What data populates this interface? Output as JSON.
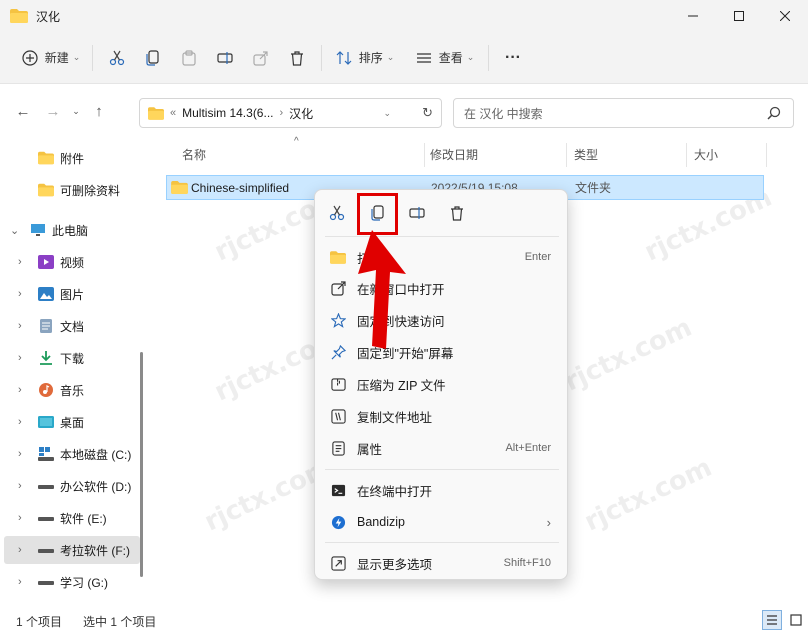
{
  "window": {
    "title": "汉化"
  },
  "toolbar": {
    "new_label": "新建",
    "sort_label": "排序",
    "view_label": "查看",
    "more_label": "···"
  },
  "navbar": {
    "path_prefix": "«",
    "path_1": "Multisim 14.3(6...",
    "path_sep": "›",
    "path_2": "汉化",
    "search_placeholder": "在 汉化 中搜索"
  },
  "sidebar": {
    "items": [
      {
        "label": "附件"
      },
      {
        "label": "可删除资料"
      },
      {
        "label": "此电脑"
      },
      {
        "label": "视频"
      },
      {
        "label": "图片"
      },
      {
        "label": "文档"
      },
      {
        "label": "下载"
      },
      {
        "label": "音乐"
      },
      {
        "label": "桌面"
      },
      {
        "label": "本地磁盘 (C:)"
      },
      {
        "label": "办公软件 (D:)"
      },
      {
        "label": "软件 (E:)"
      },
      {
        "label": "考拉软件 (F:)"
      },
      {
        "label": "学习 (G:)"
      }
    ]
  },
  "columns": {
    "name": "名称",
    "modified": "修改日期",
    "type": "类型",
    "size": "大小"
  },
  "files": [
    {
      "name": "Chinese-simplified",
      "modified": "2022/5/19 15:08",
      "type": "文件夹"
    }
  ],
  "status": {
    "count": "1 个项目",
    "selected": "选中 1 个项目"
  },
  "context_menu": {
    "items": [
      {
        "label": "打开",
        "shortcut": "Enter"
      },
      {
        "label": "在新窗口中打开",
        "shortcut": ""
      },
      {
        "label": "固定到快速访问",
        "shortcut": ""
      },
      {
        "label": "固定到\"开始\"屏幕",
        "shortcut": ""
      },
      {
        "label": "压缩为 ZIP 文件",
        "shortcut": ""
      },
      {
        "label": "复制文件地址",
        "shortcut": ""
      },
      {
        "label": "属性",
        "shortcut": "Alt+Enter"
      },
      {
        "label": "在终端中打开",
        "shortcut": ""
      },
      {
        "label": "Bandizip",
        "shortcut": ""
      },
      {
        "label": "显示更多选项",
        "shortcut": "Shift+F10"
      }
    ]
  },
  "watermark": "rjctx.com",
  "colors": {
    "selection": "#cce8ff",
    "highlight": "#e00000",
    "folder": "#f5c342",
    "accent": "#0067c0"
  }
}
